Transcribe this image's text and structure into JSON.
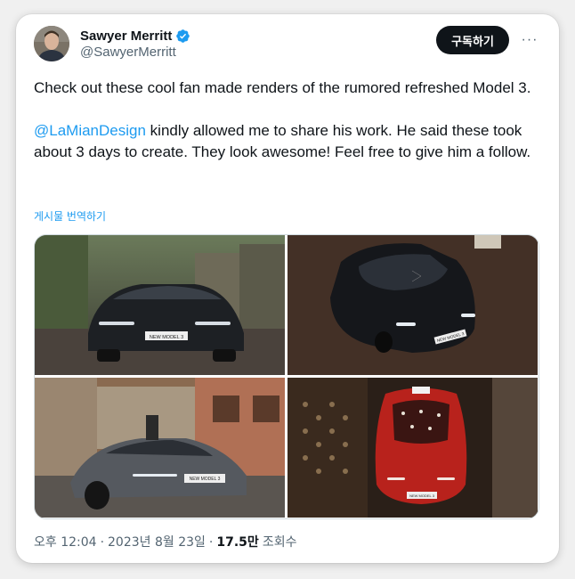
{
  "author": {
    "display_name": "Sawyer Merritt",
    "handle": "@SawyerMerritt",
    "verified": true
  },
  "actions": {
    "subscribe_label": "구독하기",
    "more_label": "···"
  },
  "tweet": {
    "paragraph1": "Check out these cool fan made renders of the rumored refreshed Model 3.",
    "mention": "@LaMianDesign",
    "paragraph2_rest": " kindly allowed me to share his work. He said these took about 3 days to create. They look awesome! Feel free to give him a follow.",
    "translate_label": "게시물 번역하기"
  },
  "media": {
    "plate_text": "NEW MODEL 3",
    "images": [
      {
        "description": "car-front-street"
      },
      {
        "description": "car-top-night"
      },
      {
        "description": "car-grey-town"
      },
      {
        "description": "car-red-top"
      }
    ]
  },
  "meta": {
    "time": "오후 12:04",
    "separator": "·",
    "date": "2023년 8월 23일",
    "views_count": "17.5만",
    "views_label": "조회수"
  },
  "colors": {
    "accent": "#1d9bf0",
    "text_primary": "#0f1419",
    "text_secondary": "#536471",
    "button_bg": "#0f1419"
  }
}
